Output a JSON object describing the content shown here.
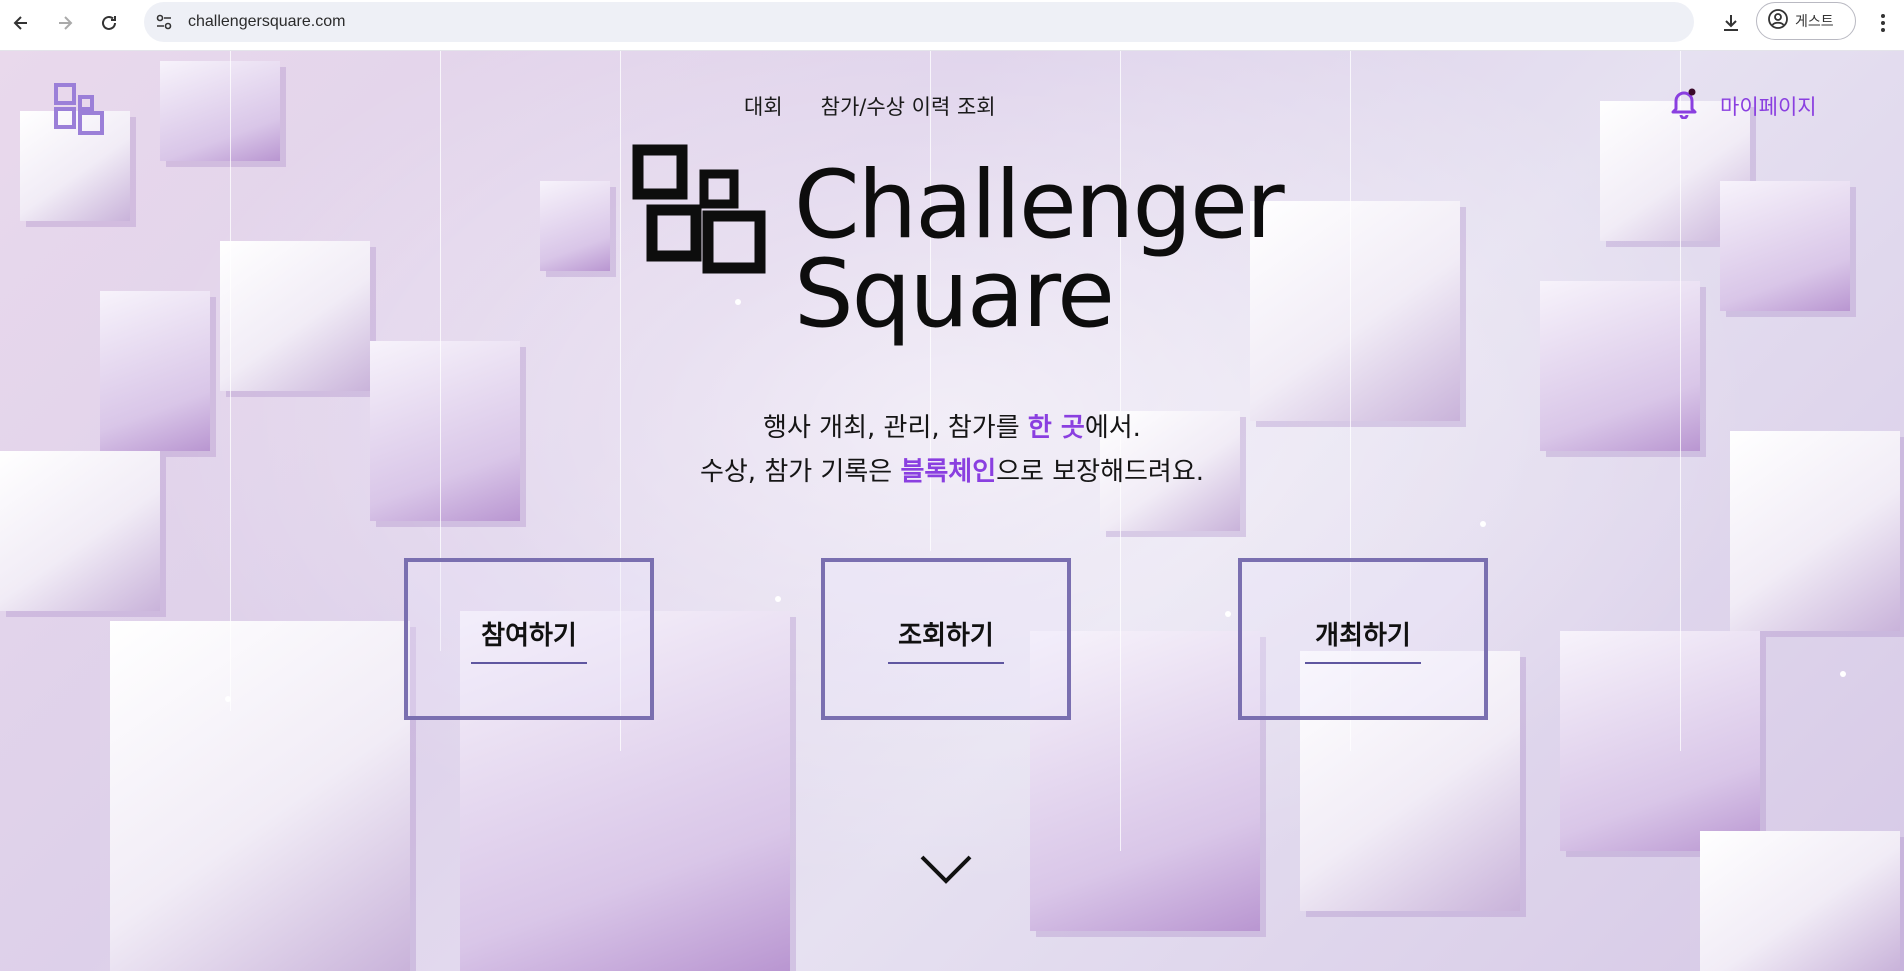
{
  "browser": {
    "url": "challengersquare.com",
    "profile_label": "게스트"
  },
  "header": {
    "nav": [
      "대회",
      "참가/수상 이력 조회"
    ],
    "mypage_label": "마이페이지"
  },
  "hero": {
    "brand_line1": "Challenger",
    "brand_line2": "Square",
    "tagline1_pre": "행사 개최, 관리, 참가를 ",
    "tagline1_hl": "한 곳",
    "tagline1_post": "에서.",
    "tagline2_pre": "수상, 참가 기록은 ",
    "tagline2_hl": "블록체인",
    "tagline2_post": "으로 보장해드려요.",
    "buttons": [
      "참여하기",
      "조회하기",
      "개최하기"
    ]
  },
  "colors": {
    "accent": "#8a3fe0",
    "button_border": "#7a6fb0"
  },
  "icons": [
    "back-arrow-icon",
    "forward-arrow-icon",
    "reload-icon",
    "site-settings-icon",
    "download-icon",
    "profile-icon",
    "more-vert-icon",
    "logo-icon",
    "bell-icon",
    "chevron-down-icon"
  ]
}
